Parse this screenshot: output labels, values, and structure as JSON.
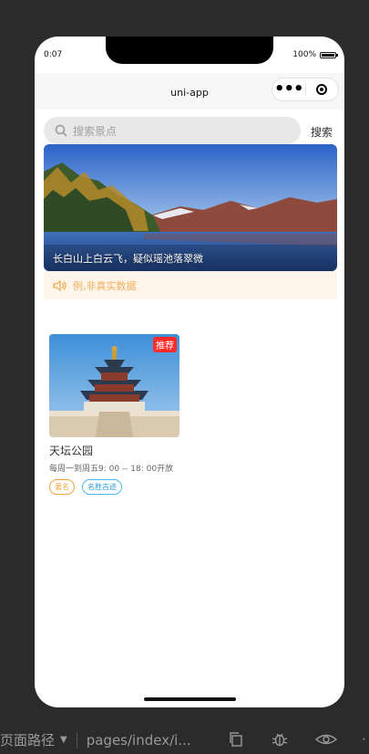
{
  "status": {
    "time": "0:07",
    "battery": "100%"
  },
  "navbar": {
    "title": "uni-app",
    "menu_icon": "more-dots-icon",
    "close_icon": "target-icon"
  },
  "search": {
    "placeholder": "搜索景点",
    "button_label": "搜索"
  },
  "banner": {
    "caption": "长白山上白云飞，疑似瑶池落翠微"
  },
  "notice": {
    "icon": "speaker-icon",
    "text": "例,非真实数据"
  },
  "cards": [
    {
      "badge": "推荐",
      "title": "天坛公园",
      "hours": "每周一到周五9: 00 -- 18: 00开放",
      "tags": [
        "著名",
        "名胜古迹"
      ]
    }
  ],
  "devbar": {
    "path_label": "页面路径",
    "page_path": "pages/index/i...",
    "icons": [
      "copy-icon",
      "bug-icon",
      "eye-icon"
    ]
  },
  "colors": {
    "notice_bg": "#fdf4ea",
    "notice_text": "#f0b05c",
    "badge": "#ff2a2a",
    "tag_orange": "#f3a33a",
    "tag_blue": "#2b9dd8"
  }
}
